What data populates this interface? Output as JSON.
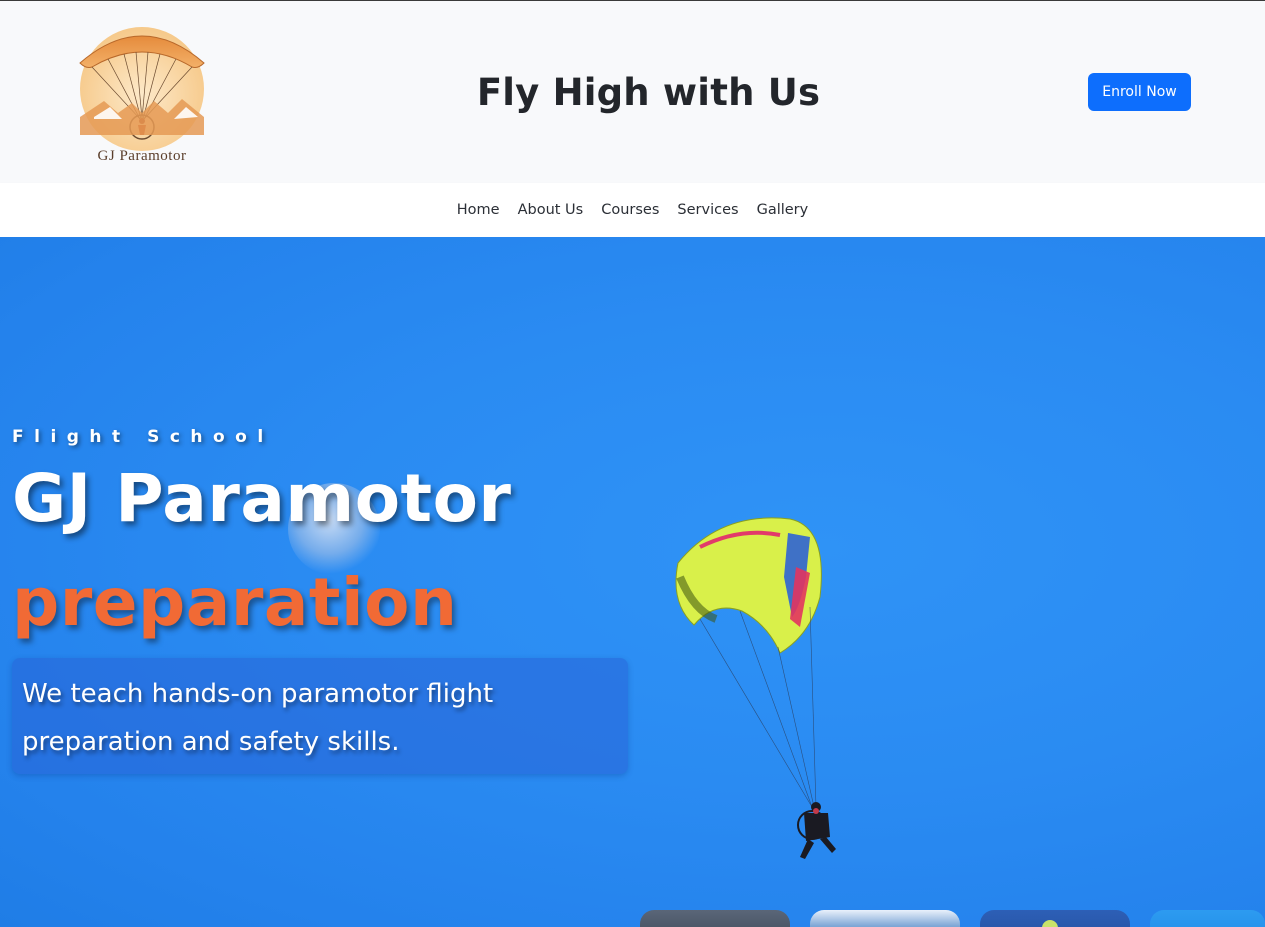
{
  "header": {
    "logo_text": "GJ Paramotor",
    "site_title": "Fly High with Us",
    "enroll_label": "Enroll Now"
  },
  "nav": {
    "items": [
      {
        "label": "Home"
      },
      {
        "label": "About Us"
      },
      {
        "label": "Courses"
      },
      {
        "label": "Services"
      },
      {
        "label": "Gallery"
      }
    ]
  },
  "hero": {
    "eyebrow": "Flight School",
    "title": "GJ Paramotor",
    "accent": "preparation",
    "description": "We teach hands-on paramotor flight preparation and safety skills."
  },
  "colors": {
    "accent_orange": "#f16a35",
    "button_blue": "#0d6efd",
    "sky_blue": "#2a8bf2"
  },
  "icons": {
    "logo": "paramotor-logo-icon",
    "paraglider": "paraglider-image"
  }
}
